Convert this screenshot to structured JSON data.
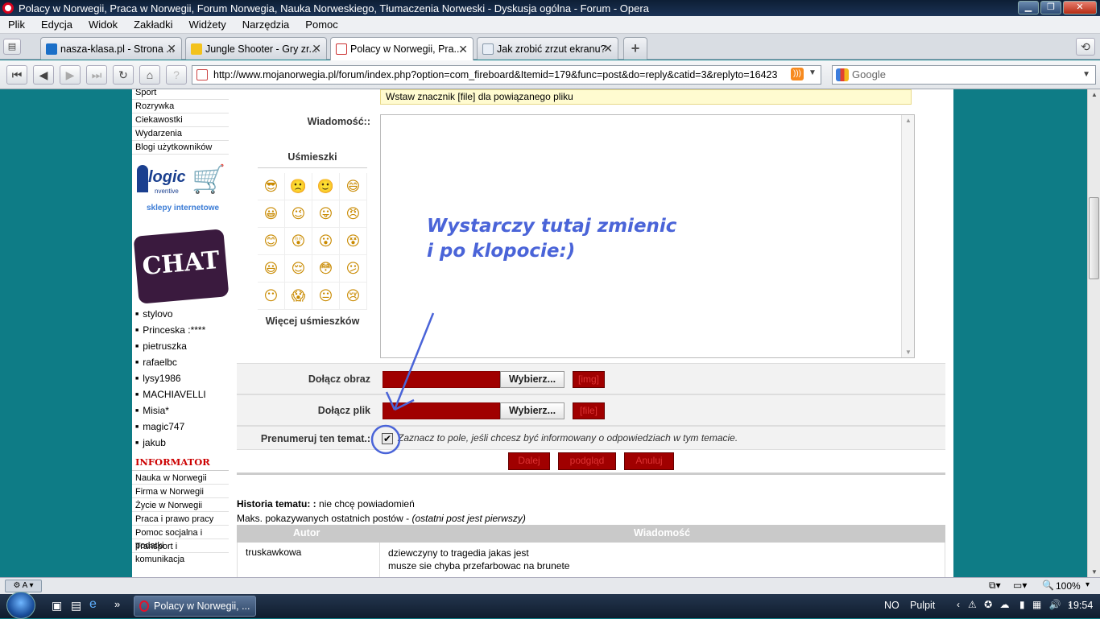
{
  "window": {
    "title": "Polacy w Norwegii, Praca w Norwegii, Forum Norwegia, Nauka Norweskiego, Tłumaczenia Norweski - Dyskusja ogólna - Forum - Opera"
  },
  "menu": [
    "Plik",
    "Edycja",
    "Widok",
    "Zakładki",
    "Widżety",
    "Narzędzia",
    "Pomoc"
  ],
  "tabs": [
    {
      "label": "nasza-klasa.pl - Strona ..."
    },
    {
      "label": "Jungle Shooter - Gry zr..."
    },
    {
      "label": "Polacy w Norwegii, Pra..."
    },
    {
      "label": "Jak zrobić zrzut ekranu?"
    }
  ],
  "address": {
    "url": "http://www.mojanorwegia.pl/forum/index.php?option=com_fireboard&Itemid=179&func=post&do=reply&catid=3&replyto=16423"
  },
  "search": {
    "placeholder": "Google"
  },
  "sidebar": {
    "top_links": [
      "Sport",
      "Rozrywka",
      "Ciekawostki",
      "Wydarzenia",
      "Blogi użytkowników"
    ],
    "logo_tagline": "sklepy internetowe",
    "logo_text": "logic",
    "logo_sub": "nventive",
    "chat_label": "CHAT",
    "users": [
      "stylovo",
      "Princeska :****",
      "pietruszka",
      "rafaelbc",
      "lysy1986",
      "MACHIAVELLI",
      "Misia*",
      "magic747",
      "jakub"
    ],
    "informator_title": "INFORMATOR",
    "informator_links": [
      "Nauka w Norwegii",
      "Firma w Norwegii",
      "Życie w Norwegii",
      "Praca i prawo pracy",
      "Pomoc socjalna i podatki",
      "Transport i komunikacja"
    ]
  },
  "form": {
    "file_notice": "Wstaw znacznik [file] dla powiązanego pliku",
    "message_label": "Wiadomość::",
    "smileys_title": "Uśmieszki",
    "more_smileys": "Więcej uśmieszków",
    "annotation_line1": "Wystarczy tutaj zmienic",
    "annotation_line2": "i po klopocie:)",
    "attach_image_label": "Dołącz obraz",
    "attach_file_label": "Dołącz plik",
    "choose_label": "Wybierz...",
    "img_tag": "[img]",
    "file_tag": "[file]",
    "subscribe_label": "Prenumeruj ten temat.:",
    "subscribe_text": "Zaznacz to pole, jeśli chcesz być informowany o odpowiedziach w tym temacie.",
    "buttons": [
      "Dalej",
      "podgląd",
      "Anuluj"
    ]
  },
  "history": {
    "title": "Historia tematu: :",
    "title_value": "nie chcę powiadomień",
    "max_label": "Maks. pokazywanych ostatnich postów -",
    "max_note": "(ostatni post jest pierwszy)",
    "col_author": "Autor",
    "col_message": "Wiadomość",
    "row_author": "truskawkowa",
    "row_line1": "dziewczyny to tragedia jakas jest",
    "row_line2": "musze sie chyba przefarbowac na brunete"
  },
  "statusbar": {
    "zoom": "100%"
  },
  "taskbar": {
    "task": "Polacy w Norwegii, ...",
    "lang": "NO",
    "desktop": "Pulpit",
    "clock": "19:54"
  }
}
